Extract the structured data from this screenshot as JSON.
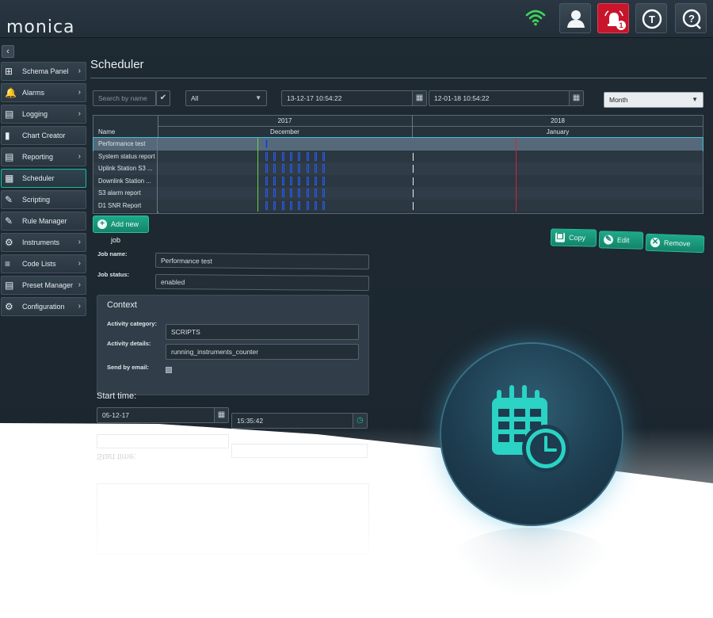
{
  "app": {
    "logo_text": "monica",
    "alarm_count": "1",
    "t_button_letter": "T",
    "colors": {
      "accent": "#1ea98a",
      "alarm": "#c8152b",
      "wifi": "#3fd65a",
      "selection": "#56697b"
    }
  },
  "sidebar": {
    "collapse_glyph": "‹",
    "items": [
      {
        "label": "Schema Panel",
        "icon": "schema-icon",
        "chevron": true
      },
      {
        "label": "Alarms",
        "icon": "bell-icon",
        "chevron": true
      },
      {
        "label": "Logging",
        "icon": "clipboard-icon",
        "chevron": true
      },
      {
        "label": "Chart Creator",
        "icon": "bar-chart-icon",
        "chevron": false
      },
      {
        "label": "Reporting",
        "icon": "report-icon",
        "chevron": true
      },
      {
        "label": "Scheduler",
        "icon": "calendar-icon",
        "chevron": false,
        "active": true
      },
      {
        "label": "Scripting",
        "icon": "script-icon",
        "chevron": false
      },
      {
        "label": "Rule Manager",
        "icon": "rule-icon",
        "chevron": false
      },
      {
        "label": "Instruments",
        "icon": "instruments-icon",
        "chevron": true
      },
      {
        "label": "Code Lists",
        "icon": "list-icon",
        "chevron": true
      },
      {
        "label": "Preset Manager",
        "icon": "preset-icon",
        "chevron": true
      },
      {
        "label": "Configuration",
        "icon": "gear-icon",
        "chevron": true
      }
    ]
  },
  "main": {
    "title": "Scheduler",
    "toolbar": {
      "search_placeholder": "Search by name",
      "filter_value": "All",
      "start_date": "13-12-17 10:54:22",
      "end_date": "12-01-18 10:54:22",
      "period_value": "Month"
    },
    "gantt": {
      "years": [
        "2017",
        "2018"
      ],
      "months": [
        "December",
        "January"
      ],
      "name_header": "Name",
      "jobs": [
        {
          "name": "Performance test",
          "selected": true
        },
        {
          "name": "System status report"
        },
        {
          "name": "Uplink Station S3 ..."
        },
        {
          "name": "Downlink Station ..."
        },
        {
          "name": "S3 alarm report"
        },
        {
          "name": "D1 SNR Report"
        }
      ]
    },
    "buttons": {
      "add_job": "Add new job",
      "copy": "Copy",
      "edit": "Edit",
      "remove": "Remove"
    },
    "form": {
      "job_name_label": "Job name:",
      "job_name_value": "Performance test",
      "job_status_label": "Job status:",
      "job_status_value": "enabled",
      "context_title": "Context",
      "activity_category_label": "Activity category:",
      "activity_category_value": "SCRIPTS",
      "activity_details_label": "Activity details:",
      "activity_details_value": "running_instruments_counter",
      "send_by_email_label": "Send by email:",
      "send_by_email_checked": false,
      "start_time_label": "Start time:",
      "start_date_value": "05-12-17",
      "start_time_value": "15:35:42"
    }
  }
}
